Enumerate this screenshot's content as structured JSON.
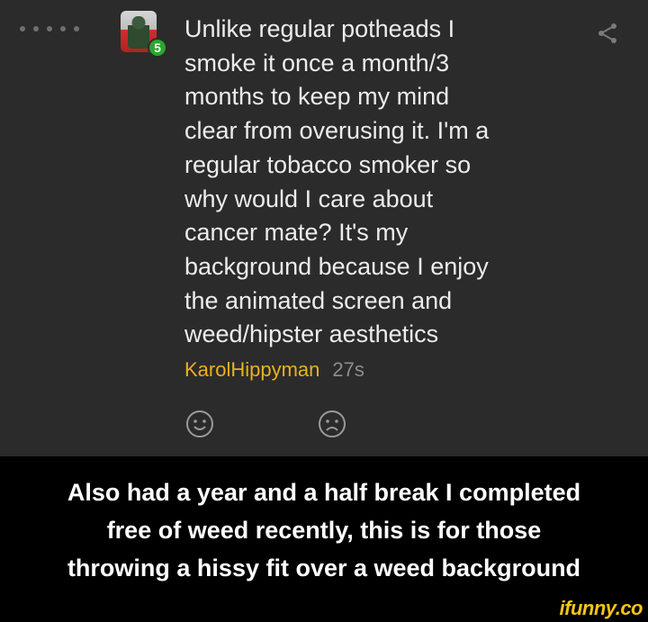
{
  "post": {
    "level": "5",
    "text": "Unlike regular potheads I\nsmoke it once a month/3\nmonths to keep my mind\nclear from overusing it. I'm a\nregular tobacco smoker so\nwhy would I care about\ncancer mate? It's my\nbackground because I enjoy\nthe animated screen and\nweed/hipster aesthetics",
    "username": "KarolHippyman",
    "time": "27s"
  },
  "caption": "Also had a year and a half break I completed\nfree of weed recently, this is for those\nthrowing a hissy fit over a weed background",
  "watermark": "ifunny.co",
  "icons": {
    "more": "dots-icon",
    "share": "share-icon",
    "like": "smile-icon",
    "dislike": "frown-icon"
  },
  "colors": {
    "card_bg": "#2b2b2b",
    "username": "#e8b21c",
    "level_badge": "#27a82e",
    "watermark": "#f5c518"
  }
}
